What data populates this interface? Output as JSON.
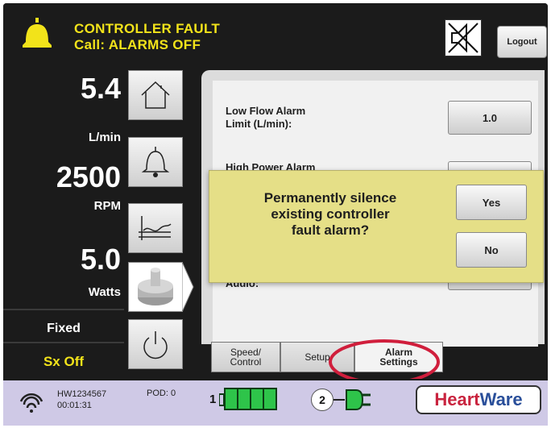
{
  "header": {
    "alarm_line1": "CONTROLLER FAULT",
    "alarm_line2": "Call: ALARMS OFF",
    "speaker_icon": "speaker-muted-icon",
    "logout_label": "Logout"
  },
  "readouts": {
    "flow_value": "5.4",
    "flow_unit": "L/min",
    "speed_value": "2500",
    "speed_unit": "RPM",
    "power_value": "5.0",
    "power_unit": "Watts",
    "mode": "Fixed",
    "status": "Sx Off"
  },
  "nav": [
    "home-icon",
    "bell-icon",
    "trend-icon",
    "pump-icon",
    "power-icon"
  ],
  "settings": {
    "low_flow_label_1": "Low Flow Alarm",
    "low_flow_label_2": "Limit (L/min):",
    "low_flow_value": "1.0",
    "high_power_peek": "High Power Alarm",
    "audio_peek": "Audio:"
  },
  "dialog": {
    "line1": "Permanently silence",
    "line2": "existing controller",
    "line3": "fault alarm?",
    "yes_label": "Yes",
    "no_label": "No"
  },
  "tabs": {
    "speed_1": "Speed/",
    "speed_2": "Control",
    "setup": "Setup",
    "alarm_1": "Alarm",
    "alarm_2": "Settings"
  },
  "footer": {
    "serial": "HW1234567",
    "time": "00:01:31",
    "pod": "POD:  0",
    "battery_1": "1",
    "battery_1_level": 1.0,
    "battery_2": "2",
    "logo_part1": "Heart",
    "logo_part2": "Ware"
  },
  "colors": {
    "alarm_yellow": "#f2e31a",
    "dialog_bg": "#e5df87",
    "highlight_ring": "#d01e3c",
    "battery_green": "#2ec44a",
    "footer_bg": "#cfc9e6"
  }
}
